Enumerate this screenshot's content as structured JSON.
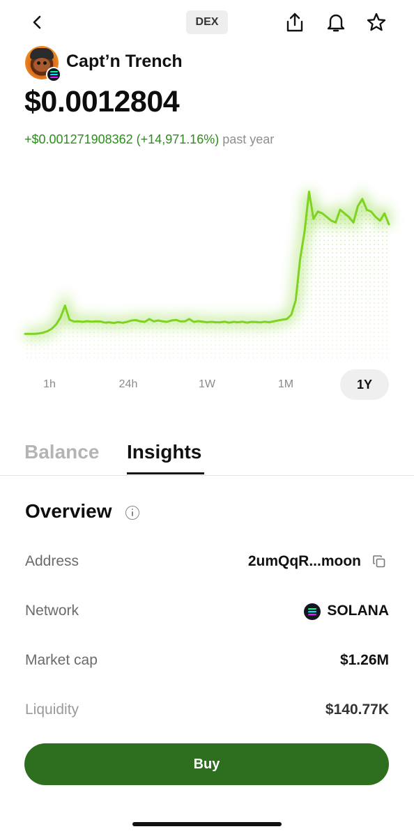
{
  "header": {
    "badge": "DEX"
  },
  "token": {
    "name": "Capt’n Trench",
    "price": "$0.0012804",
    "change_value": "+$0.001271908362 (+14,971.16%)",
    "change_period": "past year"
  },
  "colors": {
    "chart_line": "#7ed321",
    "positive": "#2e8b1e",
    "buy_button": "#2d6e1f",
    "solana_gradient": [
      "#00ffa3",
      "#03e1ff",
      "#dc1fff"
    ]
  },
  "icons": [
    "back-icon",
    "share-icon",
    "bell-icon",
    "star-icon",
    "info-icon",
    "copy-icon",
    "solana-icon"
  ],
  "chart_data": {
    "type": "line",
    "title": "",
    "period": "1Y",
    "xlabel": "",
    "ylabel": "",
    "grid": false,
    "values": [
      3.4,
      3.4,
      3.4,
      3.6,
      4.0,
      4.8,
      6.2,
      8.6,
      12.5,
      19.0,
      11.2,
      10.2,
      10.3,
      10.0,
      10.4,
      10.1,
      10.3,
      10.2,
      9.6,
      9.8,
      9.4,
      9.9,
      9.5,
      10.0,
      10.8,
      11.0,
      10.3,
      10.0,
      11.6,
      10.3,
      10.8,
      10.3,
      10.0,
      10.8,
      11.1,
      10.3,
      10.3,
      11.6,
      10.0,
      10.4,
      10.1,
      9.8,
      10.0,
      9.8,
      9.8,
      10.1,
      9.6,
      10.0,
      9.8,
      10.1,
      9.6,
      10.0,
      9.9,
      9.7,
      10.1,
      9.8,
      10.3,
      10.8,
      11.2,
      11.6,
      14.0,
      22.0,
      45.0,
      60.0,
      82.0,
      67.0,
      71.0,
      70.0,
      68.0,
      66.0,
      65.0,
      72.0,
      70.0,
      68.0,
      65.0,
      74.0,
      78.0,
      72.0,
      71.0,
      68.0,
      66.0,
      70.0,
      64.0
    ]
  },
  "timeframes": {
    "items": [
      "1h",
      "24h",
      "1W",
      "1M",
      "1Y"
    ],
    "active": "1Y"
  },
  "tabs": {
    "items": [
      "Balance",
      "Insights"
    ],
    "active": "Insights"
  },
  "overview": {
    "title": "Overview",
    "rows": [
      {
        "label": "Address",
        "value": "2umQqR...moon"
      },
      {
        "label": "Network",
        "value": "SOLANA"
      },
      {
        "label": "Market cap",
        "value": "$1.26M"
      },
      {
        "label": "Liquidity",
        "value": "$140.77K"
      }
    ]
  },
  "actions": {
    "buy_label": "Buy"
  }
}
